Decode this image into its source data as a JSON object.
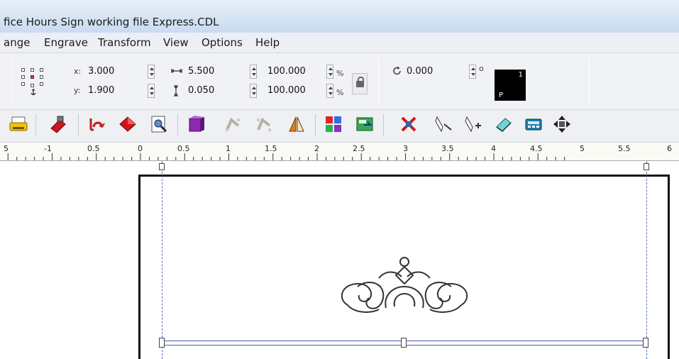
{
  "window": {
    "title": "fice Hours Sign working file Express.CDL"
  },
  "menu": [
    "ange",
    "Engrave",
    "Transform",
    "View",
    "Options",
    "Help"
  ],
  "properties": {
    "x_label": "x:",
    "x": "3.000",
    "y_label": "y:",
    "y": "1.900",
    "width": "5.500",
    "height": "0.050",
    "scale_w": "100.000",
    "scale_h": "100.000",
    "pct": "%",
    "rotation": "0.000",
    "deg": "o",
    "color_num": "1",
    "color_letter": "P"
  },
  "ruler": [
    "5",
    "-1",
    "0.5",
    "0",
    "0.5",
    "1",
    "1.5",
    "2",
    "2.5",
    "3",
    "3.5",
    "4",
    "4.5",
    "5",
    "5.5",
    "6"
  ],
  "colors": {
    "accent": "#4b5ab4",
    "guide": "#5b6fd6"
  },
  "icons": {
    "toolbar": [
      "print-icon",
      "engrave-stamp-icon",
      "undo-arc-icon",
      "diamond-red-icon",
      "preview-icon",
      "weld-icon",
      "node-edit-icon",
      "node-select-icon",
      "mirror-icon",
      "color-fill-icon",
      "export-icon",
      "delete-icon",
      "knife-icon",
      "knife-plus-icon",
      "layer-icon",
      "calculator-icon",
      "move-icon"
    ]
  }
}
